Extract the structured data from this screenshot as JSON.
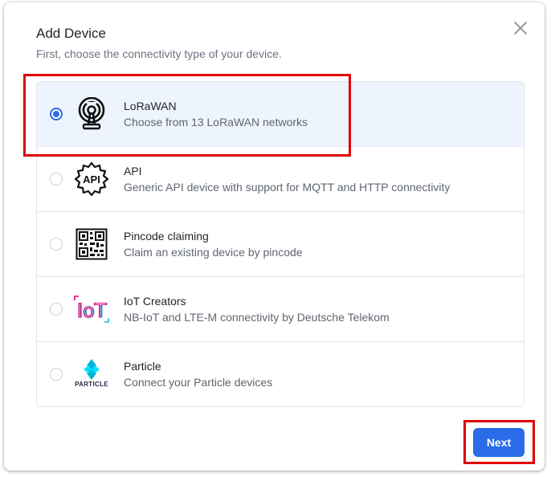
{
  "dialog": {
    "title": "Add Device",
    "subtitle": "First, choose the connectivity type of your device.",
    "next_label": "Next"
  },
  "options": [
    {
      "title": "LoRaWAN",
      "description": "Choose from 13 LoRaWAN networks",
      "icon": "antenna-tower-icon",
      "selected": true
    },
    {
      "title": "API",
      "description": "Generic API device with support for MQTT and HTTP connectivity",
      "icon": "api-gear-icon",
      "selected": false
    },
    {
      "title": "Pincode claiming",
      "description": "Claim an existing device by pincode",
      "icon": "qr-code-icon",
      "selected": false
    },
    {
      "title": "IoT Creators",
      "description": "NB-IoT and LTE-M connectivity by Deutsche Telekom",
      "icon": "iot-creators-logo",
      "logo_text": "IoT",
      "selected": false
    },
    {
      "title": "Particle",
      "description": "Connect your Particle devices",
      "icon": "particle-logo",
      "logo_text": "PARTICLE",
      "selected": false
    }
  ],
  "colors": {
    "accent": "#2a6be8",
    "selected_bg": "#eef4fd",
    "highlight": "#e00000"
  }
}
